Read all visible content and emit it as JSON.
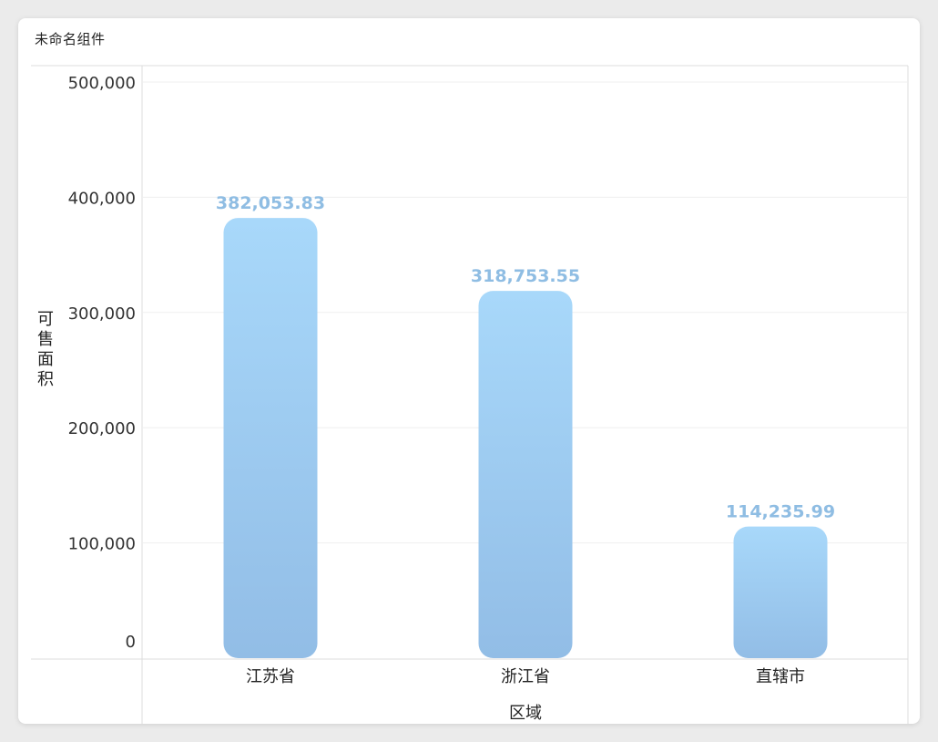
{
  "widget": {
    "title": "未命名组件"
  },
  "chart_data": {
    "type": "bar",
    "categories": [
      "江苏省",
      "浙江省",
      "直辖市"
    ],
    "values": [
      382053.83,
      318753.55,
      114235.99
    ],
    "value_labels": [
      "382,053.83",
      "318,753.55",
      "114,235.99"
    ],
    "xlabel": "区域",
    "ylabel": "可售面积",
    "ylim": [
      0,
      500000
    ],
    "yticks": [
      0,
      100000,
      200000,
      300000,
      400000,
      500000
    ],
    "ytick_labels": [
      "0",
      "100,000",
      "200,000",
      "300,000",
      "400,000",
      "500,000"
    ],
    "grid": true,
    "colors": {
      "bar_top": "#a8d8fa",
      "bar_bottom": "#92bde6",
      "value_label": "#8fbde3",
      "grid": "#efefef",
      "axis": "#d6d6d6",
      "tick_text": "#333333"
    }
  }
}
